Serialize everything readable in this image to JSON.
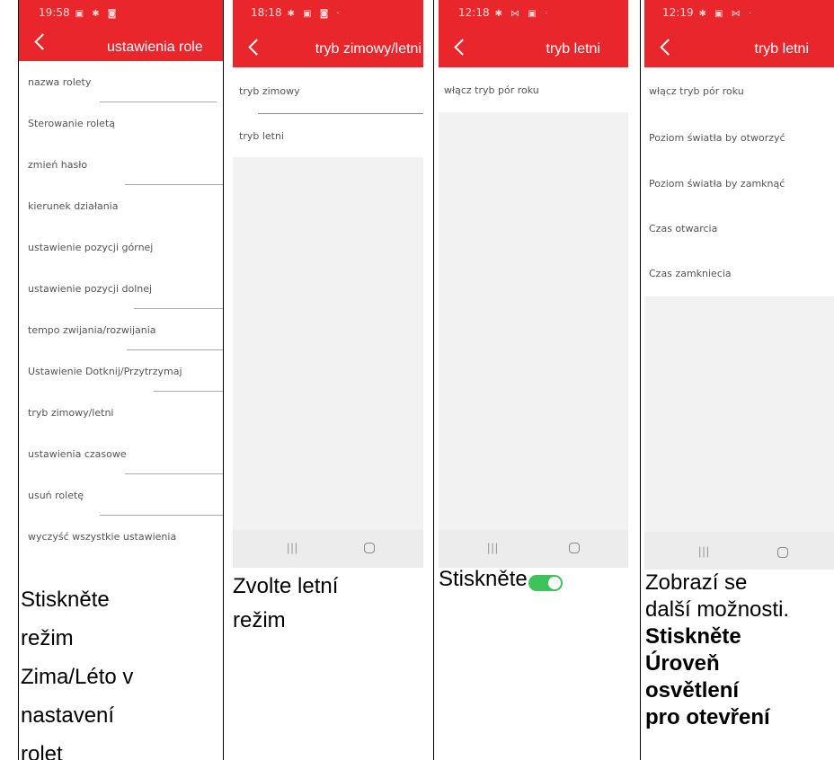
{
  "panels": [
    {
      "status_time": "19:58",
      "status_icons": "▣ ✱ ◙",
      "title": "ustawienia role",
      "items": [
        "nazwa rolety",
        "Sterowanie roletą",
        "zmień hasło",
        "kierunek działania",
        "ustawienie pozycji górnej",
        "ustawienie pozycji dolnej",
        "tempo zwijania/rozwijania",
        "Ustawienie Dotknij/Przytrzymaj",
        "tryb zimowy/letni",
        "ustawienia czasowe",
        "usuń roletę",
        "wyczyść wszystkie ustawienia"
      ],
      "caption": [
        "Stiskněte",
        "režim",
        "Zima/Léto v",
        "nastavení",
        "rolet"
      ]
    },
    {
      "status_time": "18:18",
      "status_icons": "✱ ▣ ◙ ·",
      "title": "tryb zimowy/letni",
      "items": [
        "tryb zimowy",
        "tryb letni"
      ],
      "nav_recent": "|||",
      "caption": [
        "Zvolte letní",
        "režim"
      ]
    },
    {
      "status_time": "12:18",
      "status_icons": "✱ ⋈ ▣ ·",
      "title": "tryb letni",
      "items": [
        "włącz tryb pór roku"
      ],
      "nav_recent": "|||",
      "caption_text": "Stiskněte",
      "toggle_state": "on",
      "toggle_color": "#3ec25b"
    },
    {
      "status_time": "12:19",
      "status_icons": "✱ ▣ ⋈ ·",
      "title": "tryb letni",
      "items": [
        "włącz tryb pór roku",
        "Poziom światła by otworzyć",
        "Poziom światła by zamknąć",
        "Czas otwarcia",
        "Czas zamkniecia"
      ],
      "nav_recent": "|||",
      "caption_plain": [
        "Zobrazí se",
        "další možnosti."
      ],
      "caption_bold": [
        "Stiskněte",
        "Úroveň",
        "osvětlení",
        "pro otevření"
      ]
    }
  ],
  "colors": {
    "header_red": "#e8262c",
    "toggle_green": "#3ec25b",
    "nav_gray": "#ececec"
  }
}
